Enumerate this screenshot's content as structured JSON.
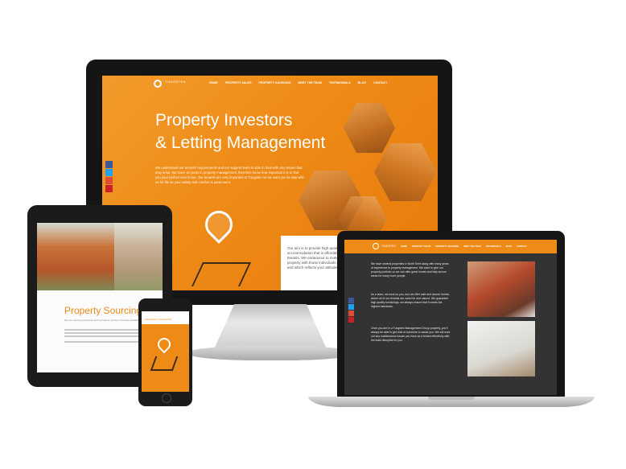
{
  "desktop": {
    "logo_text": "TUNGSTEN",
    "nav": [
      "HOME",
      "PROPERTY SALES",
      "PROPERTY SOURCING",
      "MEET THE TEAM",
      "TESTIMONIALS",
      "BLOG",
      "CONTACT"
    ],
    "hero_title_line1": "Property Investors",
    "hero_title_line2": "& Letting Management",
    "hero_paragraph": "We understand our tenants' requirements and our support team is able to deal with any issues that may arise. We have 10 years in property management, therefore know how important it is to find you your perfect new home. Our tenants are very important to Tungsten so we want you to stay with us for life as your safety and comfort is paramount.",
    "aim_text": "Our aim is to provide high quality accommodation that is affordable to our tenants. We endeavour to make sure your property with those individuals career situation and which reflects your attitude to you."
  },
  "tablet": {
    "heading": "Property Sourcing",
    "paragraph": "We are sourcing properties and we have a number of homes available."
  },
  "phone": {
    "header_text": "PROPERTY SOURCING"
  },
  "laptop": {
    "logo_text": "TUNGSTEN",
    "nav": [
      "HOME",
      "PROPERTY SALES",
      "PROPERTY SOURCING",
      "MEET THE TEAM",
      "TESTIMONIALS",
      "BLOG",
      "CONTACT"
    ],
    "paragraph1": "We have several properties in North Kent along with many years of experience in property management. We want to give our property portfolio so we can offer great homes and fully secure areas for many more people.",
    "paragraph2": "As a team, we work so you, and we offer safe and secure homes where all of our tenants are cared for and valued. We guarantee high quality furnishings, we always ensure that it meets the highest standards.",
    "paragraph3": "Once you are in a Tungsten Management Group property, you'll always be able to get hold of someone to assist you. We will work out any maintenance issues you have as a tenant effectively with the least disruption to you."
  },
  "colors": {
    "brand_orange": "#ee8a16",
    "dark_panel": "#333333"
  },
  "icons": [
    "facebook-icon",
    "twitter-icon",
    "google-plus-icon",
    "pinterest-icon",
    "location-pin-icon",
    "home-icon"
  ]
}
